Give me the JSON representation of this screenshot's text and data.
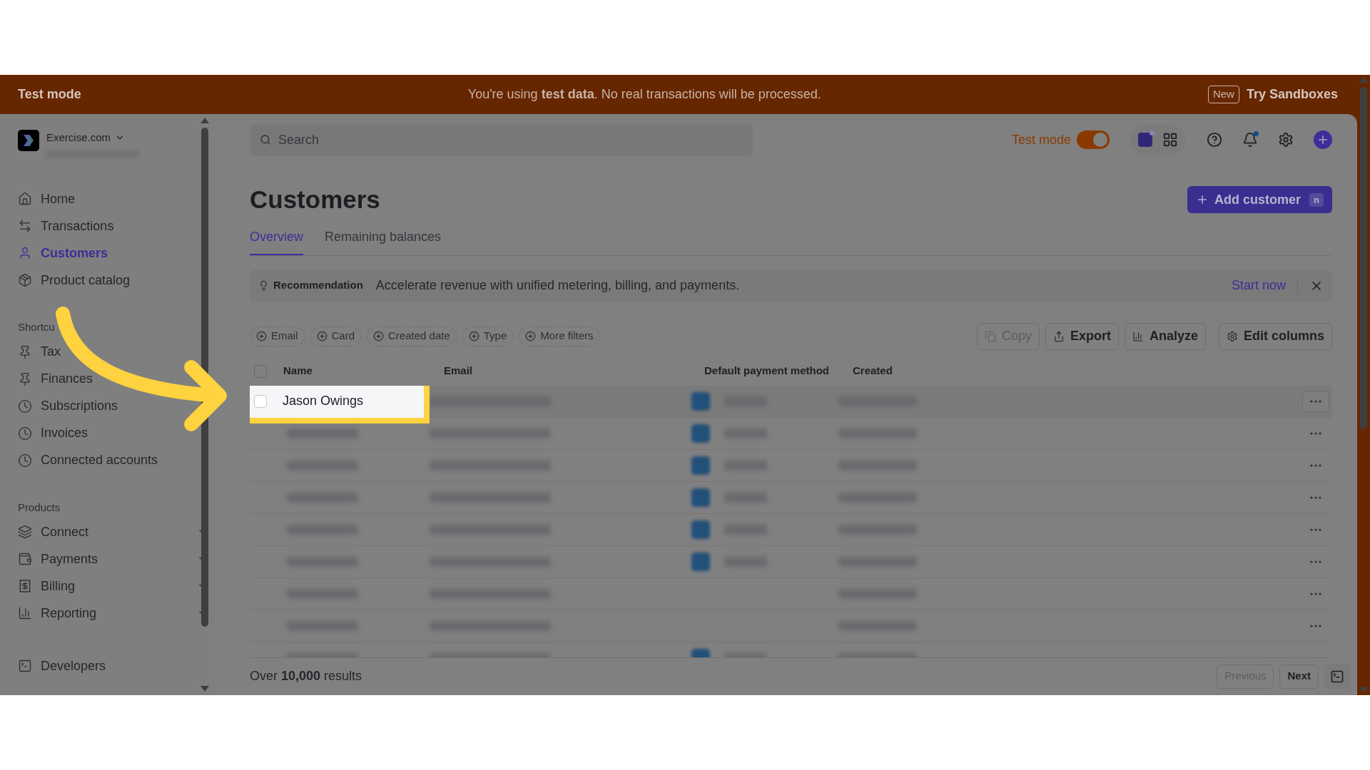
{
  "banner": {
    "label": "Test mode",
    "message": "You're using **test data**. No real transactions will be processed.",
    "badge": "New",
    "link": "Try Sandboxes"
  },
  "account": {
    "name": "Exercise.com"
  },
  "sidebar": {
    "groups": [
      {
        "items": [
          {
            "label": "Home",
            "selected": false
          },
          {
            "label": "Transactions",
            "selected": false
          },
          {
            "label": "Customers",
            "selected": true
          },
          {
            "label": "Product catalog",
            "selected": false
          }
        ]
      },
      {
        "title": "Shortcu",
        "items": [
          {
            "label": "Tax",
            "selected": false
          },
          {
            "label": "Finances",
            "selected": false
          },
          {
            "label": "Subscriptions",
            "selected": false
          },
          {
            "label": "Invoices",
            "selected": false
          },
          {
            "label": "Connected accounts",
            "selected": false
          }
        ]
      },
      {
        "title": "Products",
        "items": [
          {
            "label": "Connect",
            "selected": false,
            "expandable": true
          },
          {
            "label": "Payments",
            "selected": false,
            "expandable": true
          },
          {
            "label": "Billing",
            "selected": false,
            "expandable": true
          },
          {
            "label": "Reporting",
            "selected": false,
            "expandable": true
          }
        ]
      }
    ],
    "footer_item": {
      "label": "Developers",
      "selected": false
    }
  },
  "topbar": {
    "search": {
      "placeholder": "Search"
    },
    "test_mode": {
      "label": "Test mode",
      "on": true
    }
  },
  "header": {
    "title": "Customers",
    "add_button": "Add customer",
    "shortcut": "n"
  },
  "tabs": [
    {
      "label": "Overview",
      "selected": true
    },
    {
      "label": "Remaining balances",
      "selected": false
    }
  ],
  "recommendation": {
    "label": "Recommendation",
    "text": "Accelerate revenue with unified metering, billing, and payments.",
    "link": "Start now"
  },
  "filters": [
    "Email",
    "Card",
    "Created date",
    "Type",
    "More filters"
  ],
  "actions": [
    {
      "label": "Copy",
      "disabled": true
    },
    {
      "label": "Export",
      "disabled": false
    },
    {
      "label": "Analyze",
      "disabled": false
    },
    {
      "label": "Edit columns",
      "disabled": false
    }
  ],
  "table": {
    "columns": [
      "Name",
      "Email",
      "Default payment method",
      "Created"
    ],
    "all_checked": false,
    "rows": [
      {
        "kind": "highlighted",
        "name": "Jason Owings",
        "card": true,
        "checked": false
      },
      {
        "kind": "blurred",
        "card": true
      },
      {
        "kind": "blurred",
        "card": true
      },
      {
        "kind": "blurred",
        "card": true
      },
      {
        "kind": "blurred",
        "card": true
      },
      {
        "kind": "blurred",
        "card": true
      },
      {
        "kind": "blurred",
        "card": false
      },
      {
        "kind": "blurred",
        "card": false
      },
      {
        "kind": "partial",
        "card": true
      }
    ]
  },
  "footer": {
    "results": "Over **10,000** results",
    "buttons": [
      {
        "label": "Previous",
        "disabled": true
      },
      {
        "label": "Next",
        "disabled": false
      }
    ]
  }
}
